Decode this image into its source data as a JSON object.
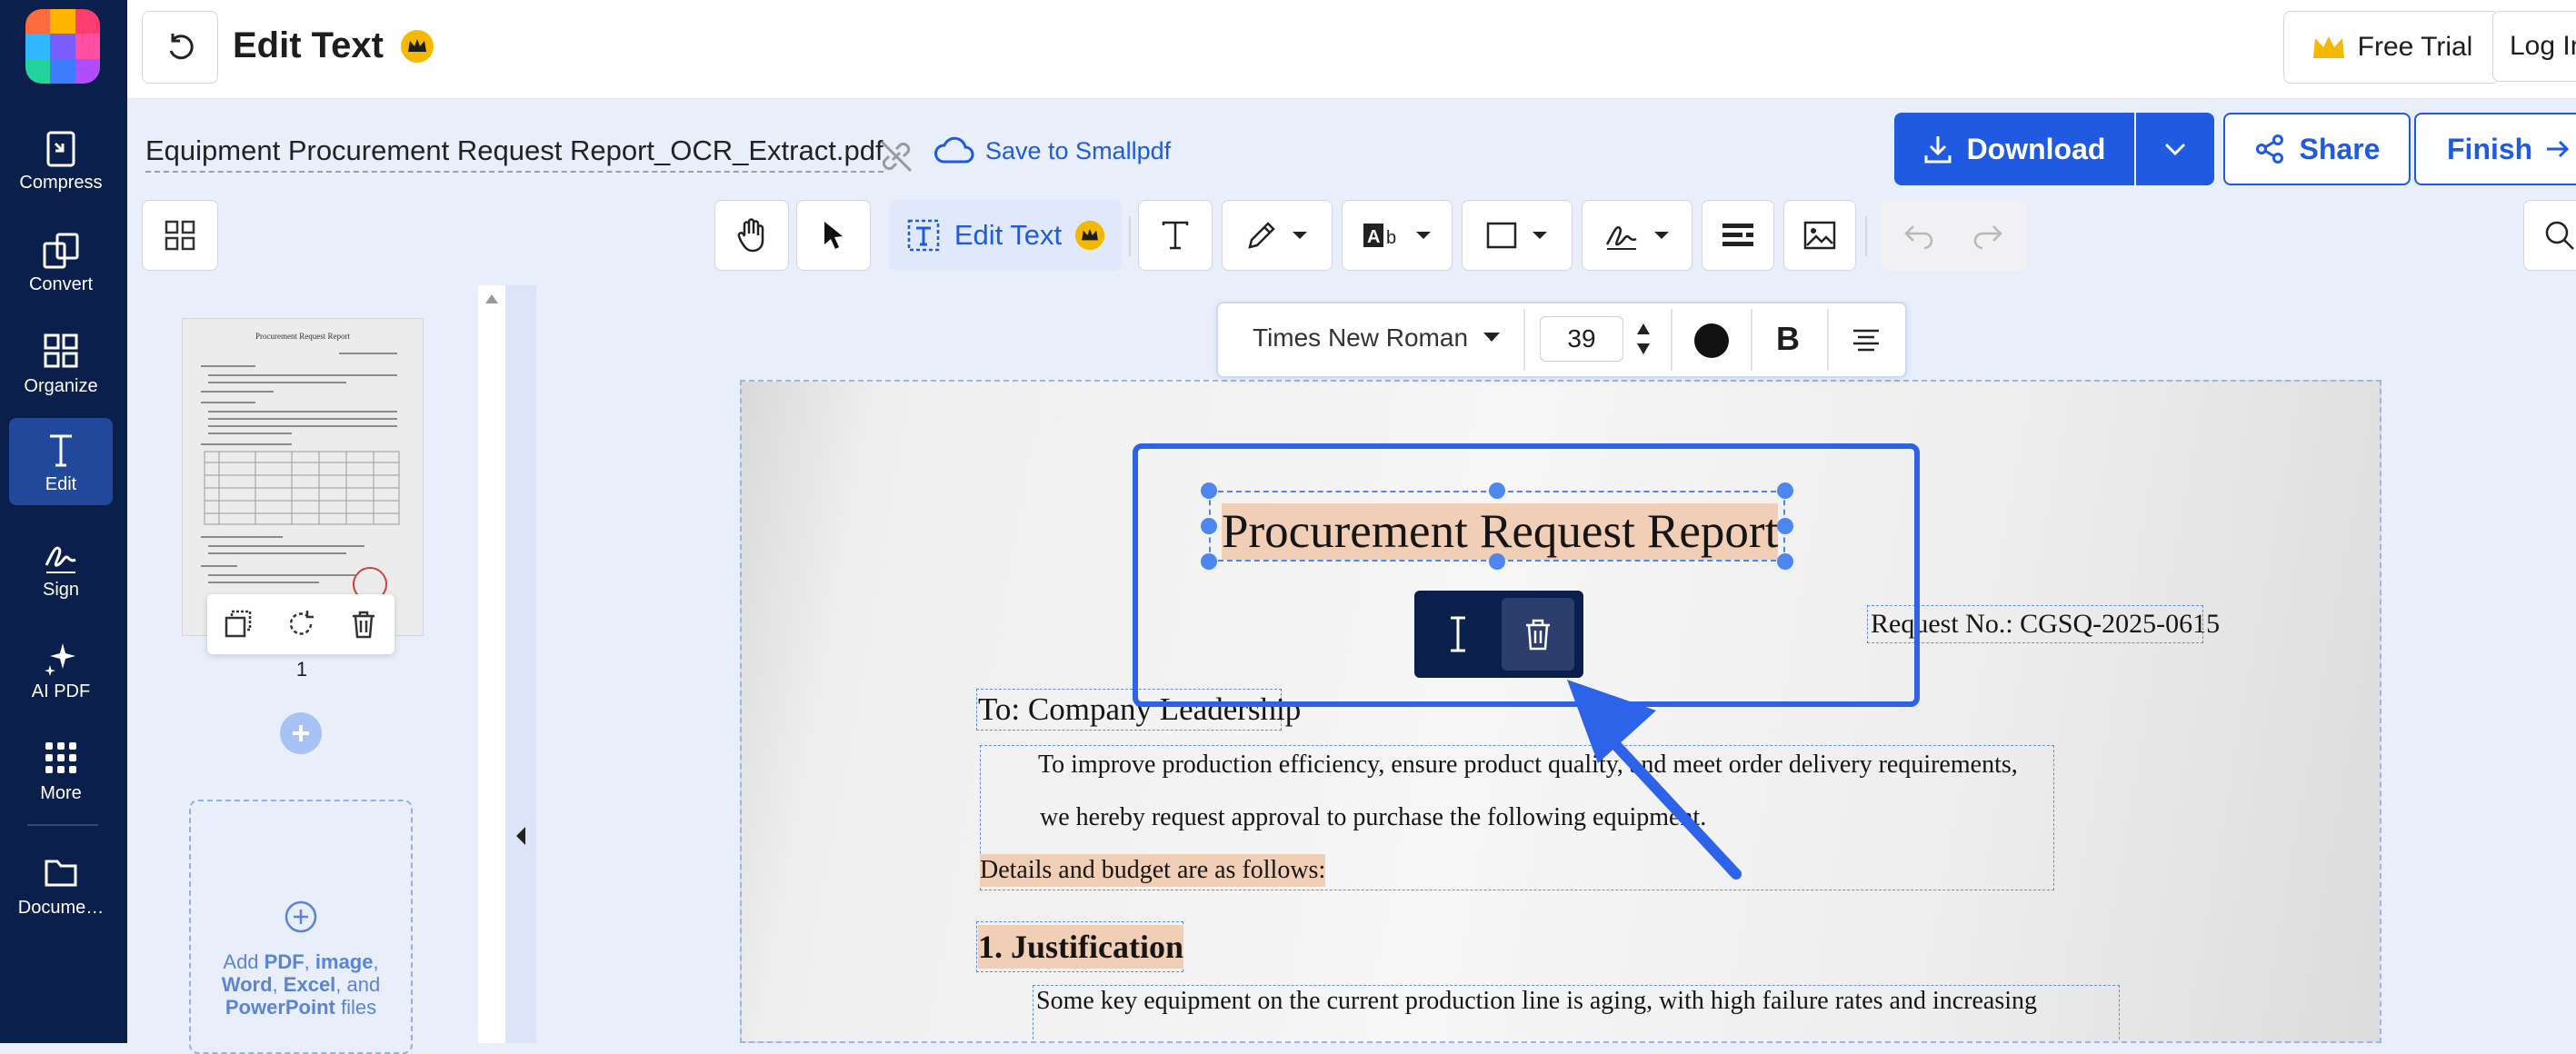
{
  "colors": {
    "accent": "#1f5ae0",
    "nav_bg": "#0b1f4d",
    "highlight": "#f0cfb6",
    "crown": "#f5b800"
  },
  "nav": {
    "items": [
      {
        "label": "Compress",
        "icon": "compress-icon"
      },
      {
        "label": "Convert",
        "icon": "convert-icon"
      },
      {
        "label": "Organize",
        "icon": "organize-icon"
      },
      {
        "label": "Edit",
        "icon": "edit-text-icon",
        "active": true
      },
      {
        "label": "Sign",
        "icon": "signature-icon"
      },
      {
        "label": "AI PDF",
        "icon": "sparkle-icon"
      },
      {
        "label": "More",
        "icon": "more-grid-icon"
      },
      {
        "label": "Docume…",
        "icon": "folder-icon"
      }
    ]
  },
  "header": {
    "title": "Edit Text",
    "free_trial": "Free Trial",
    "login": "Log In"
  },
  "file": {
    "name": "Equipment Procurement Request Report_OCR_Extract.pdf",
    "save_to": "Save to Smallpdf"
  },
  "actions": {
    "download": "Download",
    "share": "Share",
    "finish": "Finish"
  },
  "toolbar": {
    "edit_text": "Edit Text"
  },
  "text_format": {
    "font": "Times New Roman",
    "size": "39"
  },
  "thumbnails": {
    "page_number": "1",
    "drop_hint_parts": [
      "Add ",
      "PDF",
      ", ",
      "image",
      ", ",
      "Word",
      ", ",
      "Excel",
      ", and ",
      "PowerPoint",
      " files"
    ]
  },
  "document": {
    "title": "Procurement Request Report",
    "request_no": "Request No.: CGSQ-2025-0615",
    "to": "To: Company Leadership",
    "para1_line1": "To improve production efficiency, ensure product quality, and meet order delivery requirements,",
    "para1_line2": "we hereby request approval to purchase the following equipment.",
    "details": "Details and budget are as follows:",
    "heading1": "1. Justification",
    "para2_line1": "Some key equipment on the current production line is aging, with high failure rates and increasing"
  },
  "thumb_doc": {
    "title": "Procurement Request Report"
  }
}
